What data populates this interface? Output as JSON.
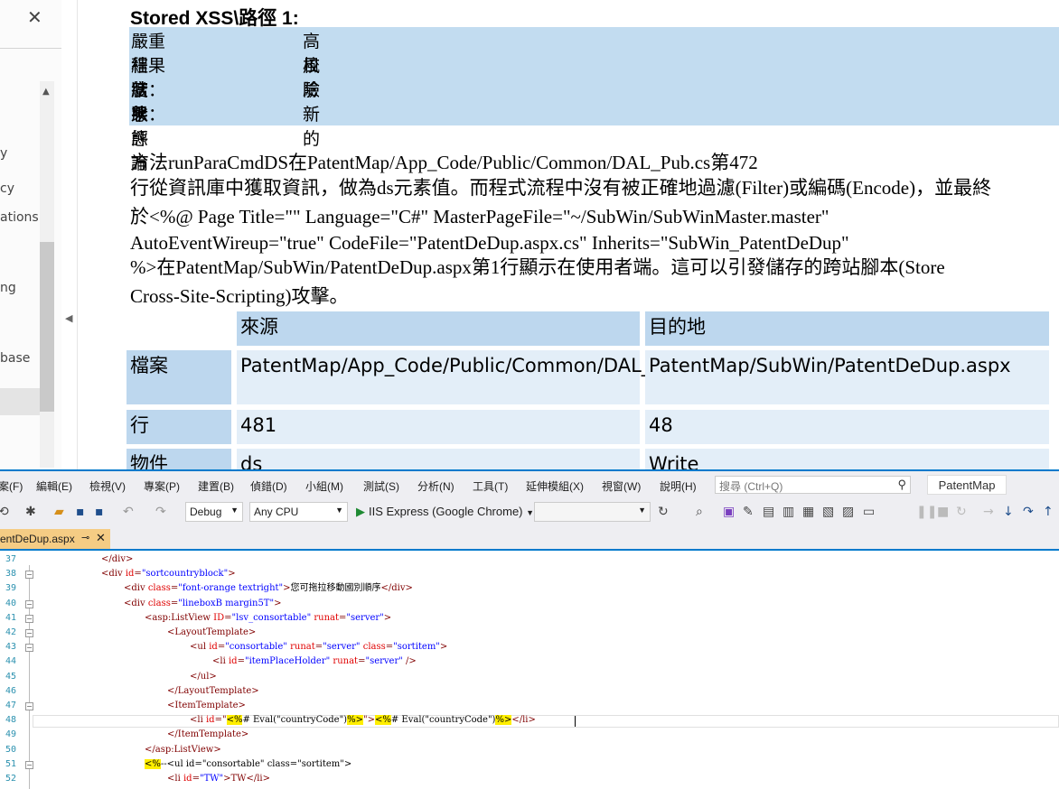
{
  "nav": {
    "items": [
      "y",
      "cy",
      "ations",
      "ng",
      "base"
    ]
  },
  "report": {
    "title": "Stored XSS\\路徑 1:",
    "summary": [
      {
        "key": "嚴重程度：",
        "value": "高風險"
      },
      {
        "key": "結果狀態：",
        "value": "校驗"
      },
      {
        "key": "結果評論",
        "value": ""
      },
      {
        "key": "狀態",
        "value": "新的"
      }
    ],
    "description": [
      "方法runParaCmdDS在PatentMap/App_Code/Public/Common/DAL_Pub.cs第472",
      "行從資訊庫中獲取資訊，做為ds元素值。而程式流程中沒有被正確地過濾(Filter)或編碼(Encode)，並最終",
      "於<%@ Page Title=\"\" Language=\"C#\" MasterPageFile=\"~/SubWin/SubWinMaster.master\"",
      "AutoEventWireup=\"true\" CodeFile=\"PatentDeDup.aspx.cs\" Inherits=\"SubWin_PatentDeDup\"",
      "%>在PatentMap/SubWin/PatentDeDup.aspx第1行顯示在使用者端。這可以引發儲存的跨站腳本(Store",
      "Cross-Site-Scripting)攻擊。"
    ],
    "table": {
      "headers": [
        "",
        "來源",
        "目的地"
      ],
      "rows": [
        {
          "label": "檔案",
          "source": "PatentMap/App_Code/Public/Common/DAL_Pub.cs",
          "dest": "PatentMap/SubWin/PatentDeDup.aspx"
        },
        {
          "label": "行",
          "source": "481",
          "dest": "48"
        },
        {
          "label": "物件",
          "source": "ds",
          "dest": "Write"
        }
      ]
    }
  },
  "vs": {
    "menu": [
      "案(F)",
      "編輯(E)",
      "檢視(V)",
      "專案(P)",
      "建置(B)",
      "偵錯(D)",
      "小組(M)",
      "測試(S)",
      "分析(N)",
      "工具(T)",
      "延伸模組(X)",
      "視窗(W)",
      "說明(H)"
    ],
    "search_placeholder": "搜尋 (Ctrl+Q)",
    "project_name": "PatentMap",
    "config": "Debug",
    "platform": "Any CPU",
    "run_target": "IIS Express (Google Chrome)",
    "tab_name": "entDeDup.aspx",
    "accent": "#007acc",
    "lines": [
      {
        "n": "37",
        "fold": false,
        "segs": [
          [
            "t",
            "</div>"
          ]
        ]
      },
      {
        "n": "38",
        "fold": true,
        "segs": [
          [
            "t",
            "<div "
          ],
          [
            "a",
            "id"
          ],
          [
            "t",
            "="
          ],
          [
            "s",
            "\"sortcountryblock\""
          ],
          [
            "t",
            ">"
          ]
        ]
      },
      {
        "n": "39",
        "fold": false,
        "segs": [
          [
            "t",
            "<div "
          ],
          [
            "a",
            "class"
          ],
          [
            "t",
            "="
          ],
          [
            "s",
            "\"font-orange textright\""
          ],
          [
            "t",
            ">"
          ],
          [
            "p",
            "您可拖拉移動國別順序"
          ],
          [
            "t",
            "</div>"
          ]
        ]
      },
      {
        "n": "40",
        "fold": true,
        "segs": [
          [
            "t",
            "<div "
          ],
          [
            "a",
            "class"
          ],
          [
            "t",
            "="
          ],
          [
            "s",
            "\"lineboxB margin5T\""
          ],
          [
            "t",
            ">"
          ]
        ]
      },
      {
        "n": "41",
        "fold": true,
        "segs": [
          [
            "t",
            "<asp:ListView "
          ],
          [
            "a",
            "ID"
          ],
          [
            "t",
            "="
          ],
          [
            "s",
            "\"lsv_consortable\""
          ],
          [
            "p",
            " "
          ],
          [
            "a",
            "runat"
          ],
          [
            "t",
            "="
          ],
          [
            "s",
            "\"server\""
          ],
          [
            "t",
            ">"
          ]
        ]
      },
      {
        "n": "42",
        "fold": true,
        "segs": [
          [
            "t",
            "<LayoutTemplate>"
          ]
        ]
      },
      {
        "n": "43",
        "fold": true,
        "segs": [
          [
            "t",
            "<ul "
          ],
          [
            "a",
            "id"
          ],
          [
            "t",
            "="
          ],
          [
            "s",
            "\"consortable\""
          ],
          [
            "p",
            " "
          ],
          [
            "a",
            "runat"
          ],
          [
            "t",
            "="
          ],
          [
            "s",
            "\"server\""
          ],
          [
            "p",
            " "
          ],
          [
            "a",
            "class"
          ],
          [
            "t",
            "="
          ],
          [
            "s",
            "\"sortitem\""
          ],
          [
            "t",
            ">"
          ]
        ]
      },
      {
        "n": "44",
        "fold": false,
        "segs": [
          [
            "t",
            "<li "
          ],
          [
            "a",
            "id"
          ],
          [
            "t",
            "="
          ],
          [
            "s",
            "\"itemPlaceHolder\""
          ],
          [
            "p",
            " "
          ],
          [
            "a",
            "runat"
          ],
          [
            "t",
            "="
          ],
          [
            "s",
            "\"server\""
          ],
          [
            "t",
            " />"
          ]
        ]
      },
      {
        "n": "45",
        "fold": false,
        "segs": [
          [
            "t",
            "</ul>"
          ]
        ]
      },
      {
        "n": "46",
        "fold": false,
        "segs": [
          [
            "t",
            "</LayoutTemplate>"
          ]
        ]
      },
      {
        "n": "47",
        "fold": true,
        "segs": [
          [
            "t",
            "<ItemTemplate>"
          ]
        ]
      },
      {
        "n": "48",
        "fold": false,
        "segs": [
          [
            "t",
            "<li "
          ],
          [
            "a",
            "id"
          ],
          [
            "t",
            "=\""
          ],
          [
            "h",
            "<%"
          ],
          [
            "p",
            "# Eval(\"countryCode\")"
          ],
          [
            "h",
            "%>"
          ],
          [
            "t",
            "\">"
          ],
          [
            "h",
            "<%"
          ],
          [
            "p",
            "# Eval(\"countryCode\")"
          ],
          [
            "h",
            "%>"
          ],
          [
            "t",
            "</li>"
          ]
        ]
      },
      {
        "n": "49",
        "fold": false,
        "segs": [
          [
            "t",
            "</ItemTemplate>"
          ]
        ]
      },
      {
        "n": "50",
        "fold": false,
        "segs": [
          [
            "t",
            "</asp:ListView>"
          ]
        ]
      },
      {
        "n": "51",
        "fold": true,
        "segs": [
          [
            "h",
            "<%"
          ],
          [
            "p",
            "--<ul id=\"consortable\" class=\"sortitem\">"
          ]
        ]
      },
      {
        "n": "52",
        "fold": false,
        "segs": [
          [
            "t",
            "<li "
          ],
          [
            "a",
            "id"
          ],
          [
            "t",
            "="
          ],
          [
            "s",
            "\"TW\""
          ],
          [
            "t",
            ">TW</li>"
          ]
        ]
      }
    ]
  }
}
